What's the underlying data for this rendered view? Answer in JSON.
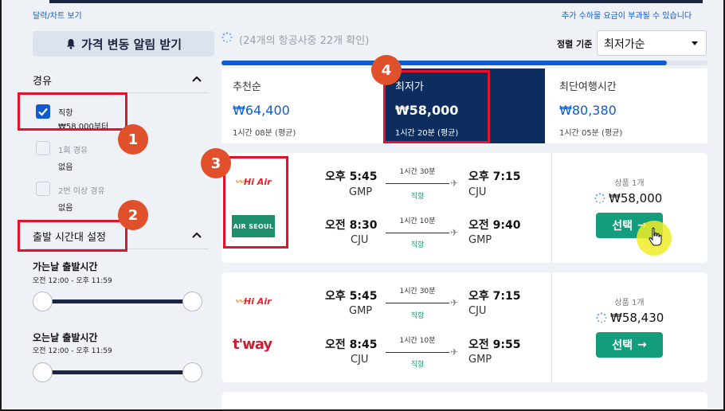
{
  "top_links": {
    "calendar_chart": "달력/차트 보기",
    "extra_fee_notice": "추가 수하물 요금이 부과될 수 있습니다"
  },
  "sidebar": {
    "alert_button": "가격 변동 알림 받기",
    "stops": {
      "title": "경유",
      "options": [
        {
          "label": "직항",
          "sub": "₩58,000부터",
          "checked": true
        },
        {
          "label": "1회 경유",
          "sub": "없음",
          "checked": false
        },
        {
          "label": "2번 이상 경유",
          "sub": "없음",
          "checked": false
        }
      ]
    },
    "departure_time": {
      "title": "출발 시간대 설정",
      "outbound_label": "가는날 출발시간",
      "outbound_range": "오전 12:00 - 오후 11:59",
      "inbound_label": "오는날 출발시간",
      "inbound_range": "오전 12:00 - 오후 11:59"
    }
  },
  "markers": [
    "1",
    "2",
    "3",
    "4"
  ],
  "status": {
    "text": "(24개의 항공사중 22개 확인)",
    "progress_fraction": 0.917
  },
  "sort": {
    "label": "정렬 기준",
    "value": "최저가순"
  },
  "tabs": [
    {
      "label": "추천순",
      "price": "₩64,400",
      "sub": "1시간 08분 (평균)",
      "active": false
    },
    {
      "label": "최저가",
      "price": "₩58,000",
      "sub": "1시간 20분 (평균)",
      "active": true
    },
    {
      "label": "최단여행시간",
      "price": "₩80,380",
      "sub": "1시간 05분 (평균)",
      "active": false
    }
  ],
  "results": [
    {
      "legs": [
        {
          "airline": "Hi Air",
          "dep_time": "오후 5:45",
          "dep_code": "GMP",
          "duration": "1시간 30분",
          "stops": "직항",
          "arr_time": "오후 7:15",
          "arr_code": "CJU"
        },
        {
          "airline": "AIR SEOUL",
          "dep_time": "오전 8:30",
          "dep_code": "CJU",
          "duration": "1시간 10분",
          "stops": "직항",
          "arr_time": "오전 9:40",
          "arr_code": "GMP"
        }
      ],
      "product_count": "상품 1개",
      "price": "₩58,000",
      "select_label": "선택"
    },
    {
      "legs": [
        {
          "airline": "Hi Air",
          "dep_time": "오후 5:45",
          "dep_code": "GMP",
          "duration": "1시간 30분",
          "stops": "직항",
          "arr_time": "오후 7:15",
          "arr_code": "CJU"
        },
        {
          "airline": "t'way",
          "dep_time": "오전 8:45",
          "dep_code": "CJU",
          "duration": "1시간 10분",
          "stops": "직항",
          "arr_time": "오전 9:55",
          "arr_code": "GMP"
        }
      ],
      "product_count": "상품 1개",
      "price": "₩58,430",
      "select_label": "선택"
    }
  ],
  "colors": {
    "accent": "#0f5bd1",
    "select_button": "#149d7c",
    "active_tab": "#0c2d5e",
    "highlight_box": "#e8102a",
    "marker": "#e0502b"
  }
}
